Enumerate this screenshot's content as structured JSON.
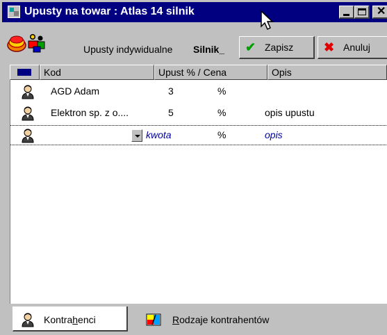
{
  "window": {
    "title": "Upusty na towar : Atlas 14 silnik",
    "close_glyph": "✕"
  },
  "toolbar": {
    "label": "Upusty indywidualne",
    "value": "Silnik_",
    "save_label": "Zapisz",
    "save_icon": "checkmark-icon",
    "cancel_label": "Anuluj",
    "cancel_icon": "cross-icon"
  },
  "table": {
    "columns": [
      "Kod",
      "Upust % / Cena",
      "Opis"
    ],
    "rows": [
      {
        "kod": "AGD Adam",
        "value": "3",
        "unit": "%",
        "opis": ""
      },
      {
        "kod": "Elektron sp. z o....",
        "value": "5",
        "unit": "%",
        "opis": "opis upustu"
      },
      {
        "kod": "",
        "value": "kwota",
        "unit": "%",
        "opis": "opis"
      }
    ]
  },
  "tabs": [
    {
      "label_pre": "Kontra",
      "label_ul": "h",
      "label_post": "enci",
      "icon": "person-icon"
    },
    {
      "label_pre": "",
      "label_ul": "R",
      "label_post": "odzaje kontrahentów",
      "icon": "types-icon"
    }
  ],
  "colors": {
    "titlebar": "#000080",
    "face": "#c0c0c0",
    "edit_text": "#0000a0"
  }
}
